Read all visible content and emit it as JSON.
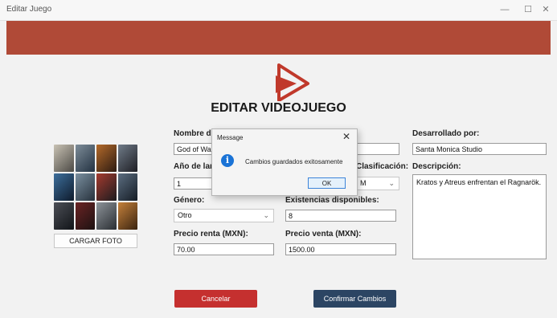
{
  "window": {
    "title": "Editar Juego",
    "minimize_icon": "minimize-icon",
    "maximize_icon": "maximize-icon",
    "close_icon": "close-icon"
  },
  "header": {
    "title": "EDITAR VIDEOJUEGO",
    "logo_icon": "play-logo-icon",
    "accent_color": "#b04a37"
  },
  "left": {
    "upload_button": "CARGAR FOTO"
  },
  "form": {
    "nombre_label": "Nombre del",
    "nombre_value": "God of War:",
    "anio_label": "Año de lanz",
    "anio_value": "1",
    "clasificacion_label": "Clasificación:",
    "clasificacion_value": "M",
    "genero_label": "Género:",
    "genero_value": "Otro",
    "existencias_label": "Existencias disponibles:",
    "existencias_value": "8",
    "renta_label": "Precio renta (MXN):",
    "renta_value": "70.00",
    "venta_label": "Precio venta (MXN):",
    "venta_value": "1500.00",
    "desarrollado_label": "Desarrollado por:",
    "desarrollado_value": "Santa Monica Studio",
    "descripcion_label": "Descripción:",
    "descripcion_value": "Kratos y Atreus enfrentan el Ragnarök."
  },
  "buttons": {
    "cancel": "Cancelar",
    "confirm": "Confirmar Cambios",
    "cancel_color": "#c5302f",
    "confirm_color": "#2c4563"
  },
  "dialog": {
    "title": "Message",
    "message": "Cambios guardados exitosamente",
    "ok": "OK",
    "icon": "info-icon"
  }
}
